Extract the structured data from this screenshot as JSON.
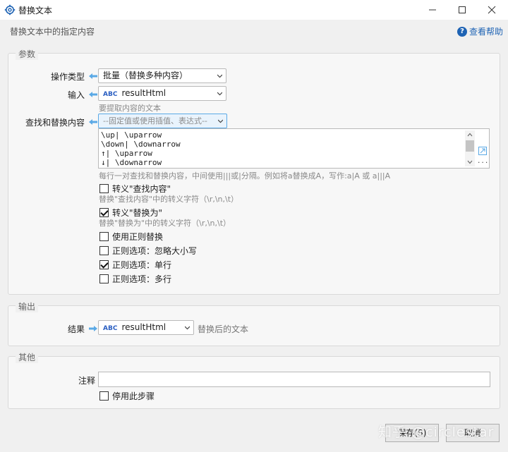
{
  "window": {
    "title": "替换文本",
    "subtitle": "替换文本中的指定内容",
    "help_label": "查看帮助",
    "controls": [
      "minimize-icon",
      "maximize-icon",
      "close-icon"
    ]
  },
  "params": {
    "group_title": "参数",
    "op_type": {
      "label": "操作类型",
      "value": "批量（替换多种内容）"
    },
    "input": {
      "label": "输入",
      "value": "resultHtml",
      "hint": "要提取内容的文本"
    },
    "find_replace": {
      "label": "查找和替换内容",
      "placeholder": "--固定值或使用插值、表达式--",
      "lines": [
        "\\up| \\uparrow",
        "\\down| \\downarrow",
        "↑| \\uparrow",
        "↓| \\downarrow"
      ],
      "hint": "每行一对查找和替换内容，中间使用|||或|分隔。例如将a替换成A，写作:a|A 或 a|||A"
    },
    "escape_find": {
      "label": "转义\"查找内容\"",
      "checked": false,
      "hint": "替换\"查找内容\"中的转义字符（\\r,\\n,\\t）"
    },
    "escape_replace": {
      "label": "转义\"替换为\"",
      "checked": true,
      "hint": "替换\"替换为\"中的转义字符（\\r,\\n,\\t）"
    },
    "use_regex": {
      "label": "使用正则替换",
      "checked": false
    },
    "regex_ignore_case": {
      "label": "正则选项：忽略大小写",
      "checked": false
    },
    "regex_single_line": {
      "label": "正则选项：单行",
      "checked": true
    },
    "regex_multi_line": {
      "label": "正则选项：多行",
      "checked": false
    }
  },
  "output": {
    "group_title": "输出",
    "result": {
      "label": "结果",
      "value": "resultHtml",
      "hint": "替换后的文本"
    }
  },
  "other": {
    "group_title": "其他",
    "note_label": "注释",
    "note_value": "",
    "disable_step": {
      "label": "停用此步骤",
      "checked": false
    }
  },
  "footer": {
    "save_label": "保存(S)",
    "cancel_label": "取消"
  },
  "watermark": "知乎 @circlestar",
  "colors": {
    "accent": "#1e63b4",
    "arrow": "#5aa9e6",
    "abc": "#2b5fc2"
  }
}
